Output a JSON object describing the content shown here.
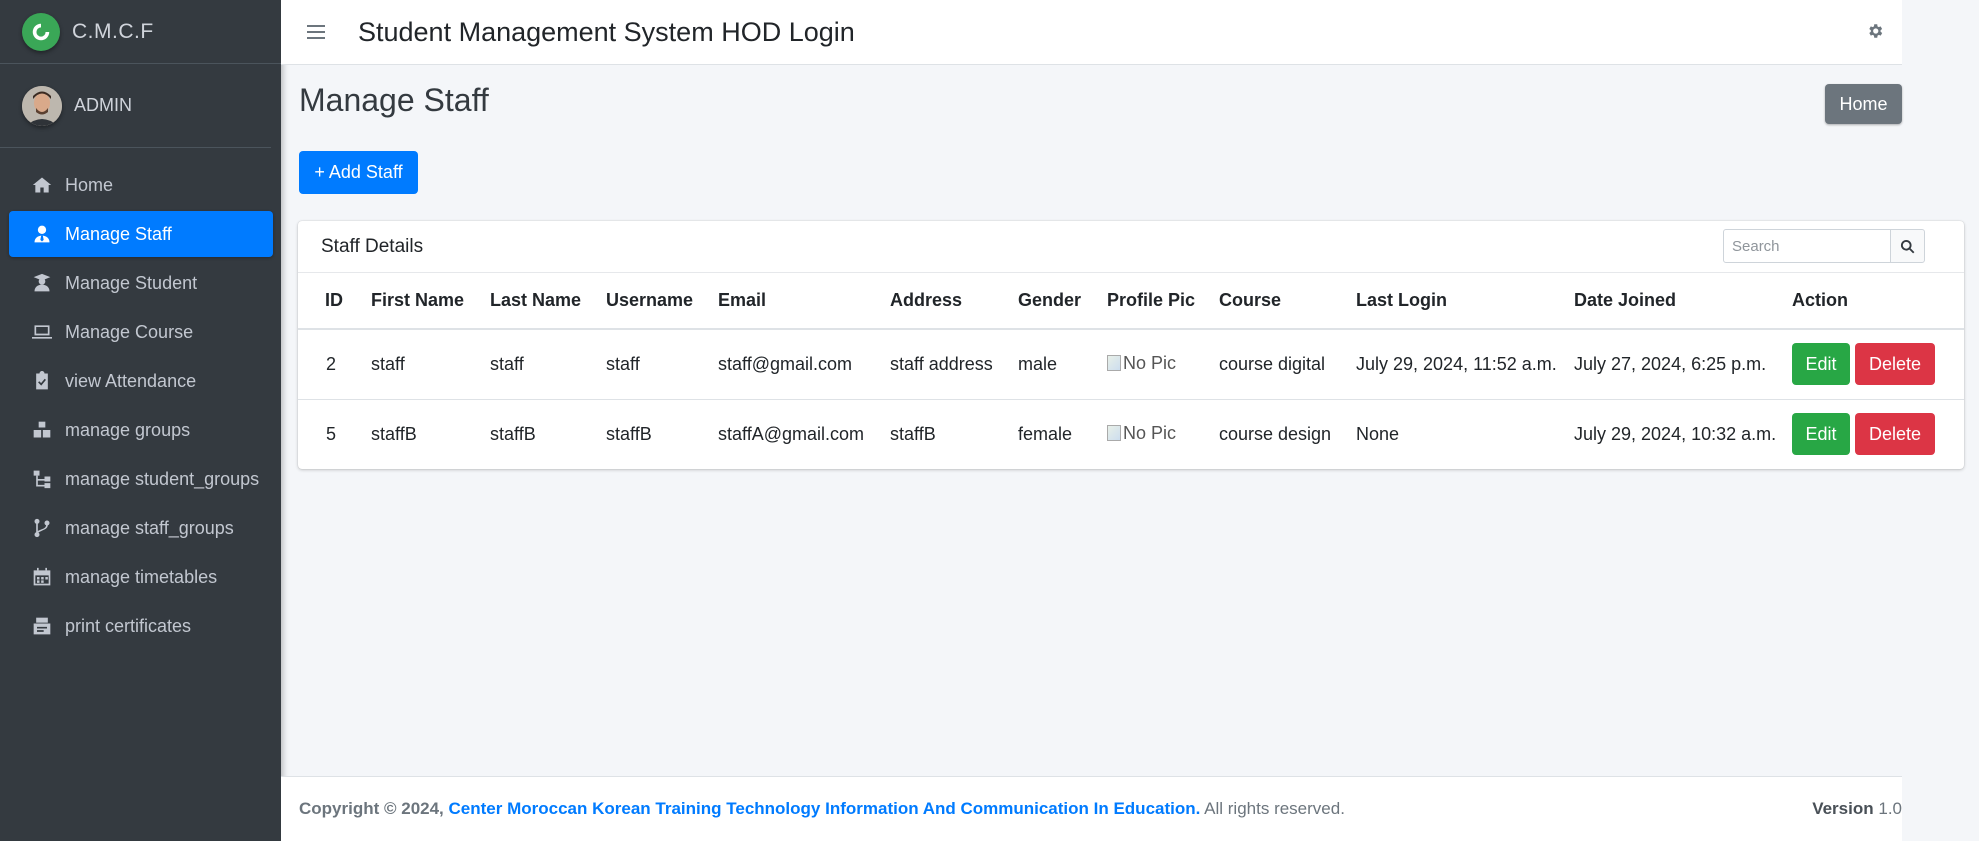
{
  "brand": {
    "name": "C.M.C.F"
  },
  "user": {
    "name": "ADMIN"
  },
  "sidebar": {
    "items": [
      {
        "label": "Home",
        "icon": "home-icon",
        "active": false
      },
      {
        "label": "Manage Staff",
        "icon": "user-tie-icon",
        "active": true
      },
      {
        "label": "Manage Student",
        "icon": "user-graduate-icon",
        "active": false
      },
      {
        "label": "Manage Course",
        "icon": "laptop-icon",
        "active": false
      },
      {
        "label": "view Attendance",
        "icon": "clipboard-check-icon",
        "active": false
      },
      {
        "label": "manage groups",
        "icon": "cubes-icon",
        "active": false
      },
      {
        "label": "manage student_groups",
        "icon": "sitemap-icon",
        "active": false
      },
      {
        "label": "manage staff_groups",
        "icon": "code-branch-icon",
        "active": false
      },
      {
        "label": "manage timetables",
        "icon": "calendar-icon",
        "active": false
      },
      {
        "label": "print certificates",
        "icon": "certificate-print-icon",
        "active": false
      }
    ]
  },
  "header": {
    "title": "Student Management System HOD Login"
  },
  "page": {
    "title": "Manage Staff",
    "home_button": "Home",
    "add_button": "+ Add Staff"
  },
  "card": {
    "title": "Staff Details",
    "search_placeholder": "Search"
  },
  "table": {
    "columns": [
      "ID",
      "First Name",
      "Last Name",
      "Username",
      "Email",
      "Address",
      "Gender",
      "Profile Pic",
      "Course",
      "Last Login",
      "Date Joined",
      "Action"
    ],
    "rows": [
      {
        "id": "2",
        "first_name": "staff",
        "last_name": "staff",
        "username": "staff",
        "email": "staff@gmail.com",
        "address": "staff address",
        "gender": "male",
        "profile_pic": "No Pic",
        "course": "course digital",
        "last_login": "July 29, 2024, 11:52 a.m.",
        "date_joined": "July 27, 2024, 6:25 p.m.",
        "edit": "Edit",
        "delete": "Delete"
      },
      {
        "id": "5",
        "first_name": "staffB",
        "last_name": "staffB",
        "username": "staffB",
        "email": "staffA@gmail.com",
        "address": "staffB",
        "gender": "female",
        "profile_pic": "No Pic",
        "course": "course design",
        "last_login": "None",
        "date_joined": "July 29, 2024, 10:32 a.m.",
        "edit": "Edit",
        "delete": "Delete"
      }
    ]
  },
  "footer": {
    "copyright_prefix": "Copyright © 2024,",
    "org_link": "Center Moroccan Korean Training Technology Information And Communication In Education.",
    "rights": "All rights reserved.",
    "version_label": "Version",
    "version_value": "1.0"
  },
  "colors": {
    "primary": "#007bff",
    "sidebar": "#343a40",
    "success": "#28a745",
    "danger": "#dc3545",
    "secondary": "#6c757d"
  }
}
